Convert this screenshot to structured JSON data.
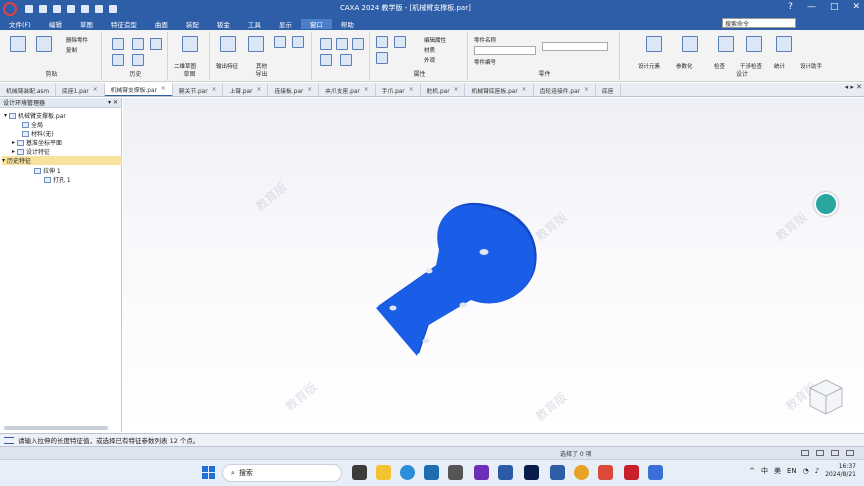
{
  "window": {
    "title": "CAXA 2024 教学版 - [机械臂支撑板.par]",
    "controls": [
      "?",
      "—",
      "□",
      "✕"
    ]
  },
  "menu": {
    "items": [
      "文件(F)",
      "编辑",
      "草图",
      "特征造型",
      "曲面",
      "装配",
      "钣金",
      "工具",
      "显示",
      "窗口",
      "帮助"
    ],
    "active_index": 9,
    "search_placeholder": "搜索命令"
  },
  "ribbon": {
    "groups": [
      {
        "label": "剪贴",
        "texts": [
          "删除零件",
          "复制"
        ]
      },
      {
        "label": "历史",
        "texts": []
      },
      {
        "label": "草图",
        "texts": [
          "二维草图"
        ]
      },
      {
        "label": "导出",
        "texts": [
          "输出特征",
          "其他"
        ]
      },
      {
        "label": "属性",
        "texts": [
          "编辑属性",
          "材质",
          "外观"
        ]
      },
      {
        "label": "零件",
        "texts": [
          "零件名称",
          "零件编号"
        ]
      },
      {
        "label": "设计",
        "texts": [
          "设计元素",
          "参数化",
          "检查",
          "干涉检查",
          "统计",
          "设计助手"
        ]
      }
    ]
  },
  "tabs": [
    {
      "label": "机械臂装配.asm",
      "active": false
    },
    {
      "label": "底座1.par",
      "active": false
    },
    {
      "label": "机械臂支撑板.par",
      "active": true
    },
    {
      "label": "腕关节.par",
      "active": false
    },
    {
      "label": "上臂.par",
      "active": false
    },
    {
      "label": "连接板.par",
      "active": false
    },
    {
      "label": "夹爪支座.par",
      "active": false
    },
    {
      "label": "手爪.par",
      "active": false
    },
    {
      "label": "舵机.par",
      "active": false
    },
    {
      "label": "机械臂底座板.par",
      "active": false
    },
    {
      "label": "齿轮连接件.par",
      "active": false
    },
    {
      "label": "底座",
      "active": false
    }
  ],
  "tree": {
    "title": "设计环境管理器",
    "nodes": [
      {
        "label": "机械臂支撑板.par",
        "level": 0,
        "selected": false
      },
      {
        "label": "全局",
        "level": 1,
        "selected": false
      },
      {
        "label": "材料(无)",
        "level": 1,
        "selected": false
      },
      {
        "label": "基准坐标平面",
        "level": 1,
        "selected": false
      },
      {
        "label": "设计特征",
        "level": 1,
        "selected": false
      },
      {
        "label": "历史特征",
        "level": 0,
        "selected": true
      },
      {
        "label": "拉伸 1",
        "level": 2,
        "selected": false
      },
      {
        "label": "打孔 1",
        "level": 2,
        "selected": false
      }
    ]
  },
  "viewport": {
    "watermark": "教育版",
    "part_color": "#1a5ee8"
  },
  "command_line": {
    "text": "请输入拉伸的长度特征值，或选择已有特征参数列表 12 个点。"
  },
  "status": {
    "text": "选择了 0 项"
  },
  "taskbar": {
    "search_label": "搜索",
    "tray": [
      "^",
      "中",
      "美",
      "EN"
    ],
    "time": "16:37",
    "date": "2024/8/21"
  }
}
